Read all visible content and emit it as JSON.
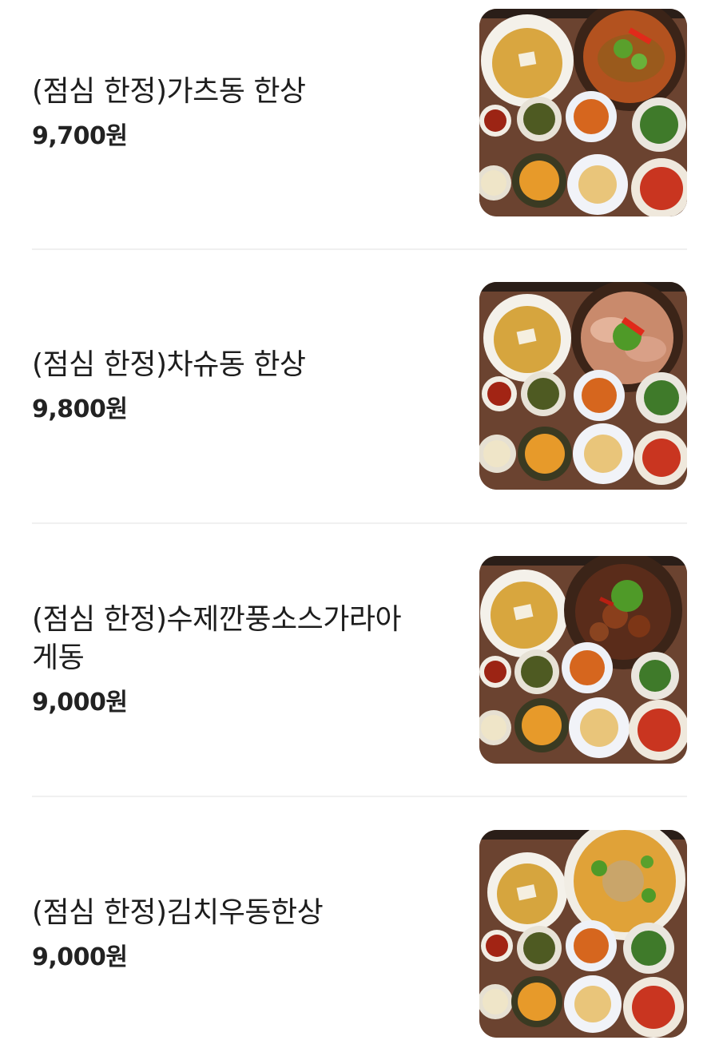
{
  "menu": {
    "items": [
      {
        "name": "(점심 한정)가츠동 한상",
        "price": "9,700원",
        "photo_icon": "katsudon-set-photo"
      },
      {
        "name": "(점심 한정)차슈동 한상",
        "price": "9,800원",
        "photo_icon": "chashudon-set-photo"
      },
      {
        "name_line1": "(점심 한정)수제깐풍소스가라아",
        "name_line2": "게동",
        "price": "9,000원",
        "photo_icon": "karaagedon-set-photo"
      },
      {
        "name": "(점심 한정)김치우동한상",
        "price": "9,000원",
        "photo_icon": "kimchi-udon-set-photo"
      }
    ]
  },
  "colors": {
    "table_wood": "#6b4330",
    "divider": "#f0f0f0",
    "text_primary": "#1d1d1d"
  }
}
